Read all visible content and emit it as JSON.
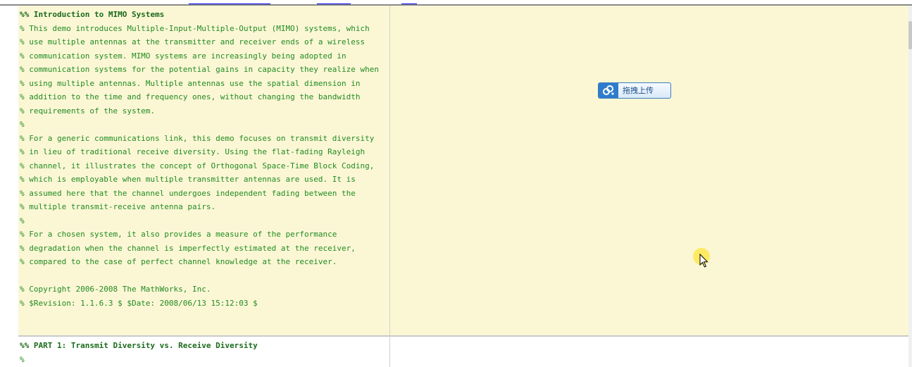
{
  "colors": {
    "cell_background": "#fbf7d5",
    "comment_text": "#228b22",
    "button_border": "#3b7bbf",
    "button_icon_bg": "#2f7ccc",
    "cursor_highlight": "#ffe63c"
  },
  "cells": [
    {
      "lines": [
        "%% Introduction to MIMO Systems",
        "% This demo introduces Multiple-Input-Multiple-Output (MIMO) systems, which",
        "% use multiple antennas at the transmitter and receiver ends of a wireless",
        "% communication system. MIMO systems are increasingly being adopted in",
        "% communication systems for the potential gains in capacity they realize when",
        "% using multiple antennas. Multiple antennas use the spatial dimension in",
        "% addition to the time and frequency ones, without changing the bandwidth",
        "% requirements of the system.",
        "%",
        "% For a generic communications link, this demo focuses on transmit diversity",
        "% in lieu of traditional receive diversity. Using the flat-fading Rayleigh",
        "% channel, it illustrates the concept of Orthogonal Space-Time Block Coding,",
        "% which is employable when multiple transmitter antennas are used. It is",
        "% assumed here that the channel undergoes independent fading between the",
        "% multiple transmit-receive antenna pairs.",
        "%",
        "% For a chosen system, it also provides a measure of the performance",
        "% degradation when the channel is imperfectly estimated at the receiver,",
        "% compared to the case of perfect channel knowledge at the receiver.",
        "",
        "% Copyright 2006-2008 The MathWorks, Inc.",
        "% $Revision: 1.1.6.3 $ $Date: 2008/06/13 15:12:03 $"
      ]
    },
    {
      "lines": [
        "%% PART 1: Transmit Diversity vs. Receive Diversity",
        "%"
      ]
    }
  ],
  "upload_button": {
    "label": "拖拽上传",
    "icon": "cloud-link-icon"
  },
  "cursor": {
    "icon": "mouse-pointer-icon"
  }
}
